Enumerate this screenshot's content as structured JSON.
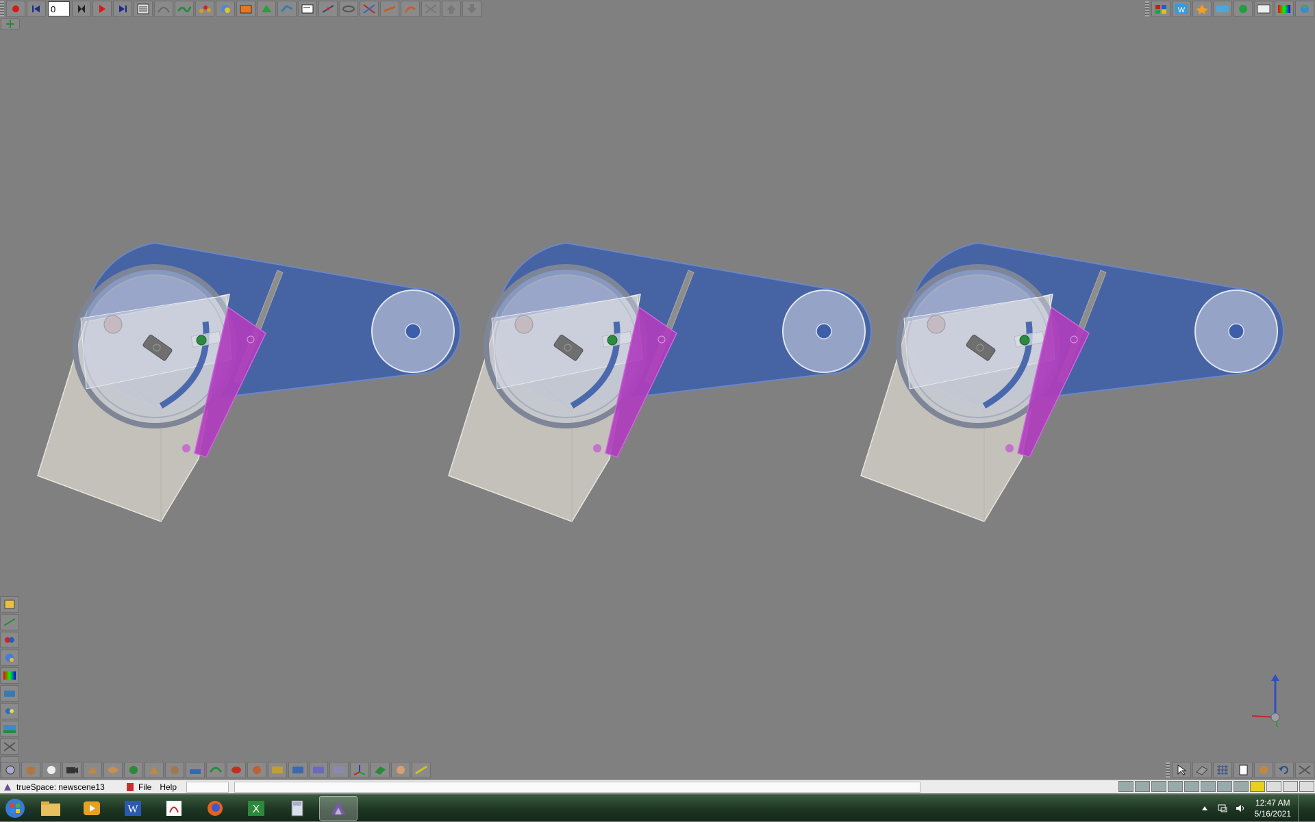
{
  "app": {
    "title": "trueSpace: newscene13",
    "menu": [
      "File",
      "Help"
    ]
  },
  "animation": {
    "current_frame": "0"
  },
  "toolbars": {
    "top_left": [
      "record-icon",
      "rewind-icon",
      "frame-input",
      "keyframe-icon",
      "play-icon",
      "end-icon",
      "script-editor-icon",
      "path-icon",
      "spline-icon",
      "ik-icon",
      "sphere-icon",
      "animate-icon",
      "nurbs-icon",
      "deform-icon",
      "bones-icon",
      "joint-icon",
      "rotate-icon",
      "scale-icon",
      "twist-icon",
      "taper-icon",
      "up-icon",
      "down-icon"
    ],
    "top_right": [
      "library-icon",
      "materials-icon",
      "effects-icon",
      "lights-icon",
      "plugin-icon",
      "sds-icon",
      "color-icon",
      "globe-icon"
    ],
    "left_palette": [
      "render-icon",
      "measure-icon",
      "palette-icon",
      "scene-icon",
      "gradient-icon",
      "camera-icon",
      "lights-icon",
      "background-icon",
      "tools-icon",
      "paint-icon"
    ],
    "bottom_left": [
      "object-tool-icon",
      "cube-icon",
      "sphere-icon",
      "camera-icon",
      "light-icon",
      "deform-icon",
      "material-icon",
      "paint-icon",
      "texture-icon",
      "boolean-icon",
      "sweep-icon",
      "lathe-icon",
      "cylinder-icon",
      "weld-icon",
      "spline-icon",
      "grid-icon",
      "array-icon",
      "axis-icon",
      "plane-icon",
      "face-icon",
      "measure-icon"
    ],
    "bottom_right": [
      "select-icon",
      "view-icon",
      "grid-icon",
      "file-icon",
      "render-icon",
      "undo-icon",
      "close-view-icon"
    ]
  },
  "taskbar": {
    "apps": [
      "start-icon",
      "file-explorer-icon",
      "media-player-icon",
      "word-icon",
      "acrobat-icon",
      "firefox-icon",
      "excel-icon",
      "calculator-icon",
      "truespace-icon"
    ],
    "time": "12:47 AM",
    "date": "5/16/2021"
  },
  "colors": {
    "background": "#808080",
    "belt_blue": "#3d5ea8",
    "pawl_magenta": "#b03cbe",
    "wheel_glass": "#c8cede",
    "box_glass": "#c9c6bd"
  }
}
